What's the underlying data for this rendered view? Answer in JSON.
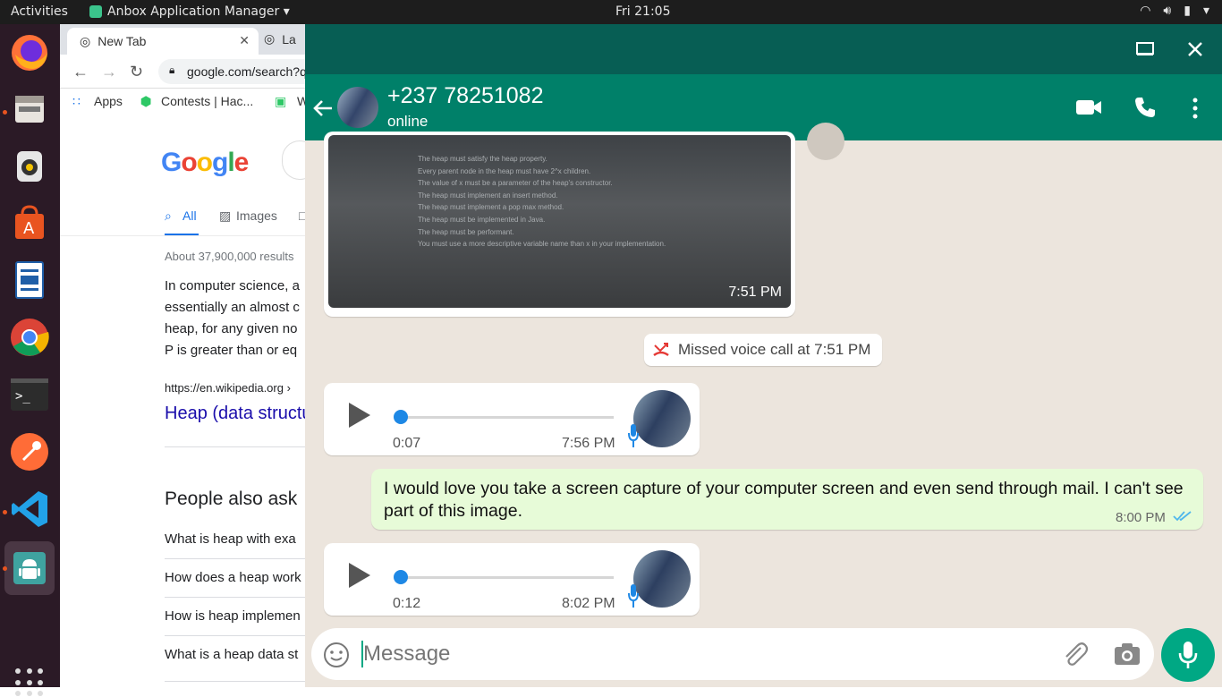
{
  "topbar": {
    "activities": "Activities",
    "app_name": "Anbox Application Manager ▾",
    "clock": "Fri 21:05"
  },
  "dock": {
    "items": [
      "firefox-icon",
      "files-icon",
      "rhythmbox-icon",
      "software-icon",
      "writer-icon",
      "chrome-icon",
      "terminal-icon",
      "postman-icon",
      "vscode-icon",
      "android-icon"
    ]
  },
  "chrome": {
    "tab1": "New Tab",
    "tab2": "La",
    "url": "google.com/search?q",
    "bookmarks": [
      "Apps",
      "Contests | Hac...",
      "W"
    ],
    "logo": "Google",
    "tabs": [
      "All",
      "Images"
    ],
    "results_count": "About 37,900,000 results",
    "snippet": [
      "In computer science, a",
      "essentially an almost c",
      "heap, for any given no",
      "P is greater than or eq"
    ],
    "result_url": "https://en.wikipedia.org ›",
    "result_title": "Heap (data structu",
    "paa_title": "People also ask",
    "paa": [
      "What is heap with exa",
      "How does a heap work",
      "How is heap implemen",
      "What is a heap data st"
    ]
  },
  "whatsapp": {
    "contact": "+237 78251082",
    "status": "online",
    "image_time": "7:51 PM",
    "image_lines": [
      "The heap must satisfy the heap property.",
      "Every parent node in the heap must have 2^x children.",
      "The value of x must be a parameter of the heap's constructor.",
      "The heap must implement an insert method.",
      "The heap must implement a pop max method.",
      "The heap must be implemented in Java.",
      "The heap must be performant.",
      "You must use a more descriptive variable name than x in your implementation."
    ],
    "missed_call": "Missed voice call at 7:51 PM",
    "voice1": {
      "duration": "0:07",
      "time": "7:56 PM"
    },
    "text_message": "I would love you take a screen capture of your computer screen and even send through mail. I can't see part of this image.",
    "text_time": "8:00 PM",
    "voice2": {
      "duration": "0:12",
      "time": "8:02 PM"
    },
    "compose_placeholder": "Message"
  },
  "colors": {
    "wa_header": "#008069",
    "wa_window": "#075e54",
    "outgoing": "#e7fbd8",
    "accent": "#00a884"
  }
}
